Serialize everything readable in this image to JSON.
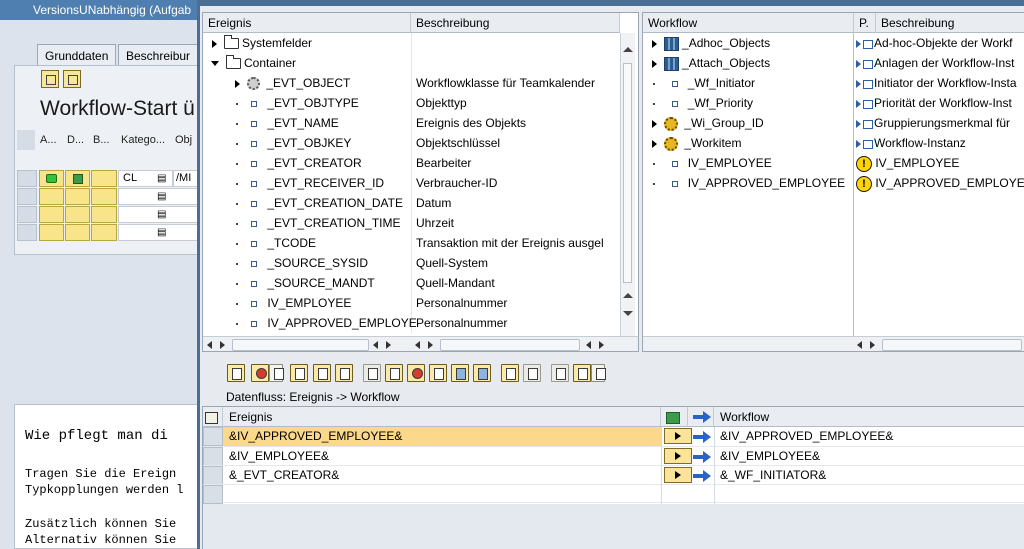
{
  "background": {
    "window_title": "VersionsUNabhängig (Aufgab",
    "tabs": [
      "Grunddaten",
      "Beschreibur"
    ],
    "section_title": "Workflow-Start ü",
    "grid_headers": [
      "A...",
      "D...",
      "B...",
      "Katego...",
      "Obj"
    ],
    "grid_row1": {
      "category": "CL",
      "object": "/MI"
    },
    "doc_lines": [
      "Wie pflegt man di",
      "Tragen Sie die Ereign",
      "Typkopplungen werden l",
      "Zusätzlich können Sie",
      "Alternativ können Sie"
    ]
  },
  "left_tree": {
    "col_event": "Ereignis",
    "col_desc": "Beschreibung",
    "rows": [
      {
        "name": "Systemfelder",
        "desc": "",
        "type": "folder",
        "toggle": "collapsed"
      },
      {
        "name": "Container",
        "desc": "",
        "type": "folder",
        "toggle": "expanded"
      },
      {
        "name": "_EVT_OBJECT",
        "desc": "Workflowklasse für Teamkalender",
        "type": "object"
      },
      {
        "name": "_EVT_OBJTYPE",
        "desc": "Objekttyp",
        "type": "attr"
      },
      {
        "name": "_EVT_NAME",
        "desc": "Ereignis des Objekts",
        "type": "attr"
      },
      {
        "name": "_EVT_OBJKEY",
        "desc": "Objektschlüssel",
        "type": "attr"
      },
      {
        "name": "_EVT_CREATOR",
        "desc": "Bearbeiter",
        "type": "attr"
      },
      {
        "name": "_EVT_RECEIVER_ID",
        "desc": "Verbraucher-ID",
        "type": "attr"
      },
      {
        "name": "_EVT_CREATION_DATE",
        "desc": "Datum",
        "type": "attr"
      },
      {
        "name": "_EVT_CREATION_TIME",
        "desc": "Uhrzeit",
        "type": "attr"
      },
      {
        "name": "_TCODE",
        "desc": "Transaktion mit der Ereignis ausgel",
        "type": "attr"
      },
      {
        "name": "_SOURCE_SYSID",
        "desc": "Quell-System",
        "type": "attr"
      },
      {
        "name": "_SOURCE_MANDT",
        "desc": "Quell-Mandant",
        "type": "attr"
      },
      {
        "name": "IV_EMPLOYEE",
        "desc": "Personalnummer",
        "type": "attr"
      },
      {
        "name": "IV_APPROVED_EMPLOYEE",
        "desc": "Personalnummer",
        "type": "attr"
      }
    ]
  },
  "right_tree": {
    "col_workflow": "Workflow",
    "col_p": "P.",
    "col_desc": "Beschreibung",
    "rows": [
      {
        "name": "_Adhoc_Objects",
        "desc": "Ad-hoc-Objekte der Workf",
        "icon": "grid",
        "toggle": true,
        "pic": "rel-out"
      },
      {
        "name": "_Attach_Objects",
        "desc": "Anlagen der Workflow-Inst",
        "icon": "grid",
        "toggle": true,
        "pic": "rel-out"
      },
      {
        "name": "_Wf_Initiator",
        "desc": "Initiator der Workflow-Insta",
        "icon": "attr",
        "toggle": false,
        "pic": "rel-in"
      },
      {
        "name": "_Wf_Priority",
        "desc": "Priorität der Workflow-Inst",
        "icon": "attr",
        "toggle": false,
        "pic": "rel-out"
      },
      {
        "name": "_Wi_Group_ID",
        "desc": "Gruppierungsmerkmal für",
        "icon": "gear-y",
        "toggle": true,
        "pic": "rel-out"
      },
      {
        "name": "_Workitem",
        "desc": "Workflow-Instanz",
        "icon": "gear-y",
        "toggle": true,
        "pic": "rel-out"
      },
      {
        "name": "IV_EMPLOYEE",
        "desc": "IV_EMPLOYEE",
        "icon": "attr",
        "toggle": false,
        "pic": "warn"
      },
      {
        "name": "IV_APPROVED_EMPLOYEE",
        "desc": "IV_APPROVED_EMPLOYEE",
        "icon": "attr",
        "toggle": false,
        "pic": "warn"
      }
    ]
  },
  "flow": {
    "label": "Datenfluss: Ereignis  -> Workflow",
    "col_event": "Ereignis",
    "col_workflow": "Workflow",
    "rows": [
      {
        "event": "&IV_APPROVED_EMPLOYEE&",
        "workflow": "&IV_APPROVED_EMPLOYEE&",
        "selected": true
      },
      {
        "event": "&IV_EMPLOYEE&",
        "workflow": "&IV_EMPLOYEE&",
        "selected": false
      },
      {
        "event": "&_EVT_CREATOR&",
        "workflow": "&_WF_INITIATOR&",
        "selected": false
      },
      {
        "event": "",
        "workflow": "",
        "selected": false
      }
    ]
  },
  "colors": {
    "dialog_border": "#4d6e93",
    "selected_row": "#fbd88a",
    "button_yellow": "#fbe49a",
    "arrow_blue": "#2a63c6"
  }
}
